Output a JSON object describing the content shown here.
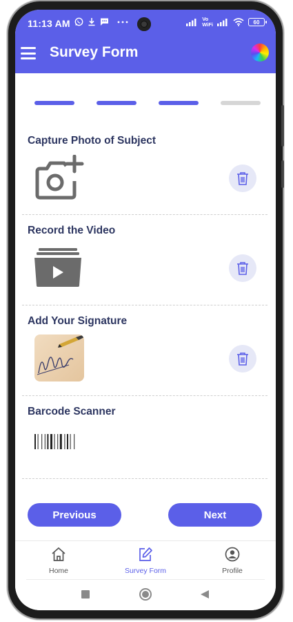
{
  "status_bar": {
    "time": "11:13 AM",
    "left_icons": [
      "whatsapp-icon",
      "download-icon",
      "message-icon",
      "more-dots-icon"
    ],
    "vo_wifi_top": "Vo",
    "vo_wifi_bottom": "WiFi",
    "battery": "60"
  },
  "app_bar": {
    "title": "Survey Form",
    "menu_icon": "hamburger-menu-icon",
    "avatar_icon": "color-wheel-icon"
  },
  "progress": {
    "total_steps": 4,
    "completed_steps": 3,
    "active_color": "#5b5fe8",
    "inactive_color": "#d6d6d6"
  },
  "sections": {
    "photo": {
      "title": "Capture Photo of Subject",
      "icon": "add-camera-icon"
    },
    "video": {
      "title": "Record the Video",
      "icon": "video-folder-icon"
    },
    "signature": {
      "title": "Add Your Signature",
      "icon": "signature-image"
    },
    "barcode": {
      "title": "Barcode Scanner",
      "icon": "barcode-icon"
    }
  },
  "buttons": {
    "previous": "Previous",
    "next": "Next"
  },
  "bottom_nav": {
    "items": [
      {
        "label": "Home",
        "icon": "home-icon",
        "active": false
      },
      {
        "label": "Survey Form",
        "icon": "edit-form-icon",
        "active": true
      },
      {
        "label": "Profile",
        "icon": "profile-icon",
        "active": false
      }
    ]
  },
  "colors": {
    "primary": "#5b5fe8",
    "heading": "#2c3560",
    "trash_bg": "#e6e8f7"
  }
}
